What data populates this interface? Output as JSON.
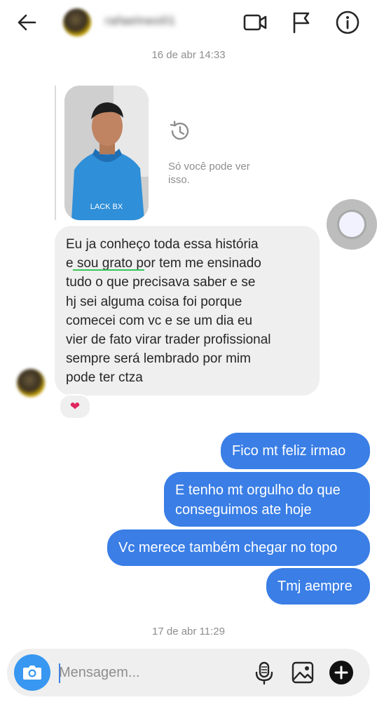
{
  "header": {
    "username": "rafaelneo01"
  },
  "timestamps": {
    "first": "16 de abr 14:33",
    "second": "17 de abr 11:29"
  },
  "story": {
    "note": "Só você pode ver isso.",
    "shirt_text": "LACK BX"
  },
  "received": {
    "text": "Eu ja conheço toda essa história\ne sou grato por tem me ensinado\ntudo o que precisava saber e se\nhj sei alguma coisa foi porque\ncomecei com vc e se um dia eu\nvier de fato virar trader profissional\nsempre será lembrado por mim\npode ter ctza",
    "reaction": "❤"
  },
  "sent": [
    {
      "text": "Fico mt feliz irmao"
    },
    {
      "text": "E tenho mt orgulho do que\nconseguimos ate hoje"
    },
    {
      "text": "Vc merece também chegar no topo"
    },
    {
      "text": "Tmj aempre"
    }
  ],
  "composer": {
    "placeholder": "Mensagem..."
  },
  "colors": {
    "accent": "#3a7ee6",
    "camera": "#3897f0",
    "bubble_in": "#efefef",
    "timestamp": "#8e8e8e"
  },
  "icons": [
    "back-arrow-icon",
    "video-call-icon",
    "flag-icon",
    "info-icon",
    "history-icon",
    "camera-icon",
    "microphone-icon",
    "gallery-icon",
    "plus-icon",
    "heart-icon"
  ]
}
